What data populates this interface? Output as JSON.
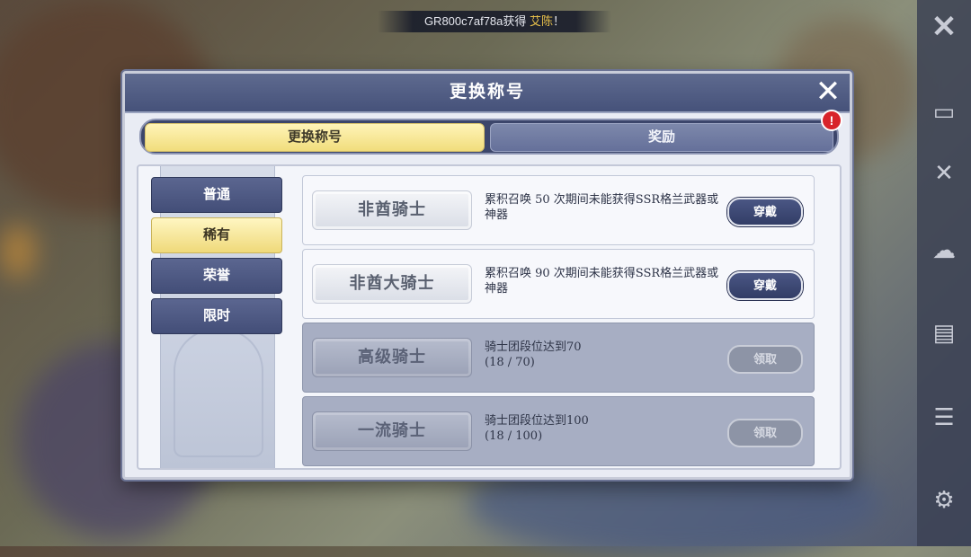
{
  "notice": {
    "player": "GR800c7af78a",
    "action": "获得",
    "item": "艾陈",
    "suffix": "！"
  },
  "dialog": {
    "title": "更换称号",
    "tabs": [
      {
        "label": "更换称号",
        "active": true
      },
      {
        "label": "奖励",
        "active": false,
        "badge": "!"
      }
    ]
  },
  "categories": [
    {
      "label": "普通",
      "selected": false
    },
    {
      "label": "稀有",
      "selected": true
    },
    {
      "label": "荣誉",
      "selected": false
    },
    {
      "label": "限时",
      "selected": false
    }
  ],
  "titles": [
    {
      "name": "非酋骑士",
      "desc": "累积召唤 50 次期间未能获得SSR格兰武器或神器",
      "progress": "",
      "action": "穿戴",
      "state": "unlocked"
    },
    {
      "name": "非酋大骑士",
      "desc": "累积召唤 90 次期间未能获得SSR格兰武器或神器",
      "progress": "",
      "action": "穿戴",
      "state": "unlocked"
    },
    {
      "name": "高级骑士",
      "desc": "骑士团段位达到70",
      "progress": "(18 / 70)",
      "action": "领取",
      "state": "locked"
    },
    {
      "name": "一流骑士",
      "desc": "骑士团段位达到100",
      "progress": "(18 / 100)",
      "action": "领取",
      "state": "locked"
    }
  ],
  "colors": {
    "accent_gold": "#f1dd7c",
    "header_navy": "#46527a",
    "badge_red": "#d8242a"
  }
}
